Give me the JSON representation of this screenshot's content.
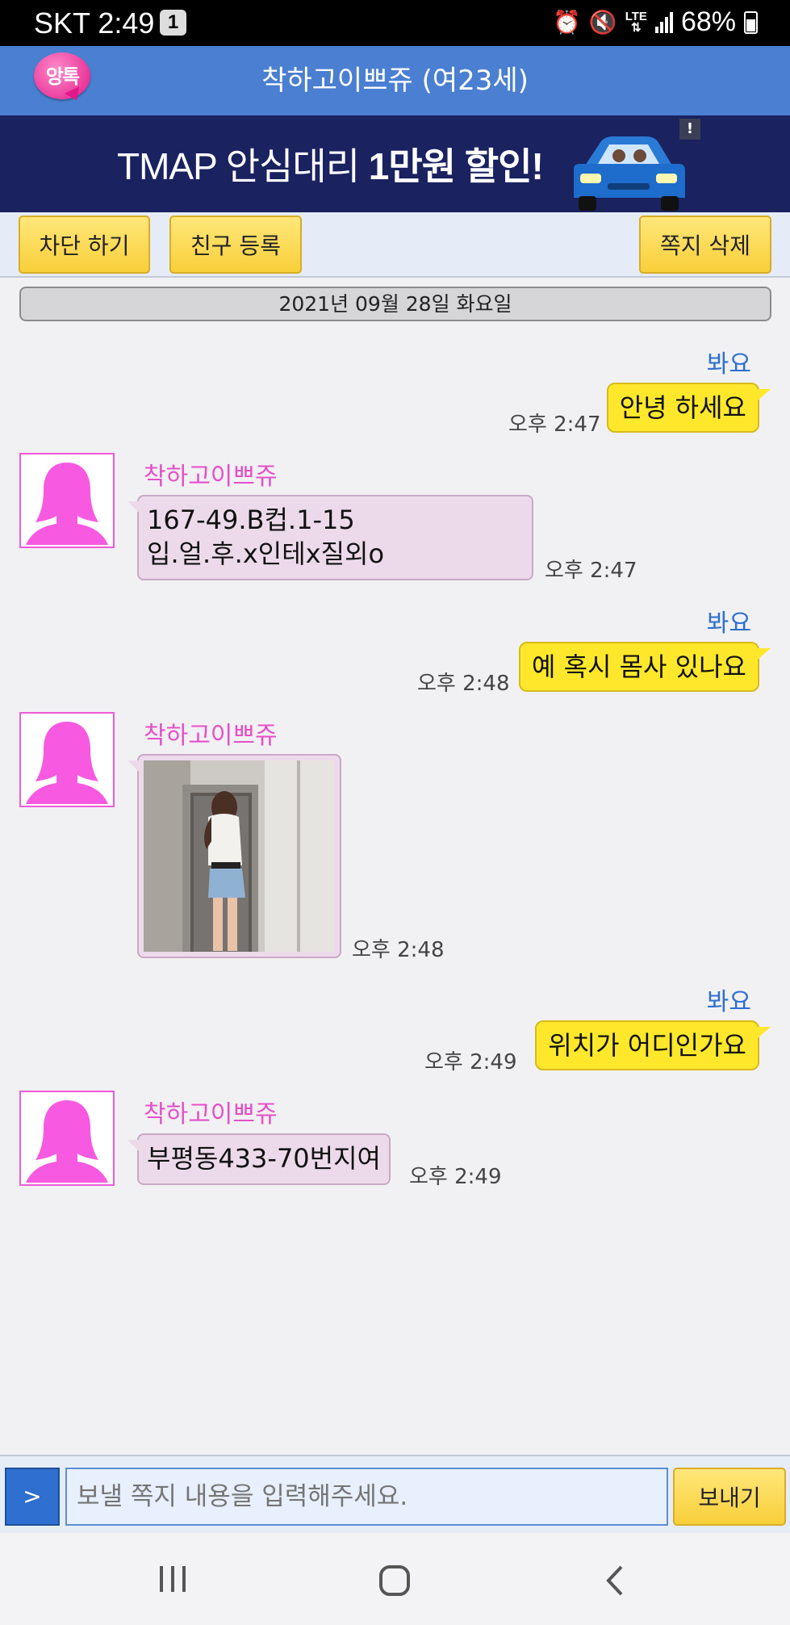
{
  "status_bar": {
    "carrier_time": "SKT 2:49",
    "notification_count": "1",
    "network": "LTE",
    "battery": "68%"
  },
  "app": {
    "logo_text": "앙톡",
    "title": "착하고이쁘쥬 (여23세)",
    "accent_color": "#4a7fd1"
  },
  "ad": {
    "text_regular": "TMAP 안심대리 ",
    "text_bold": "1만원 할인!",
    "badge": "!"
  },
  "actions": {
    "block": "차단 하기",
    "add_friend": "친구 등록",
    "delete_note": "쪽지 삭제"
  },
  "date_header": "2021년 09월 28일 화요일",
  "messages": [
    {
      "from": "me",
      "sender": "봐요",
      "text": "안녕 하세요",
      "time": "오후 2:47"
    },
    {
      "from": "other",
      "sender": "착하고이쁘쥬",
      "lines": [
        "167-49.B컵.1-15",
        "입.얼.후.x인테x질외o"
      ],
      "time": "오후 2:47"
    },
    {
      "from": "me",
      "sender": "봐요",
      "text": "예 혹시 몸사 있나요",
      "time": "오후 2:48"
    },
    {
      "from": "other",
      "sender": "착하고이쁘쥬",
      "image": "photo",
      "time": "오후 2:48"
    },
    {
      "from": "me",
      "sender": "봐요",
      "text": "위치가 어디인가요",
      "time": "오후 2:49"
    },
    {
      "from": "other",
      "sender": "착하고이쁘쥬",
      "text": "부평동433-70번지여",
      "time": "오후 2:49"
    }
  ],
  "composer": {
    "toggle_label": ">",
    "placeholder": "보낼 쪽지 내용을 입력해주세요.",
    "send_label": "보내기"
  },
  "nav_icons": [
    "recent-apps-icon",
    "home-icon",
    "back-icon"
  ]
}
